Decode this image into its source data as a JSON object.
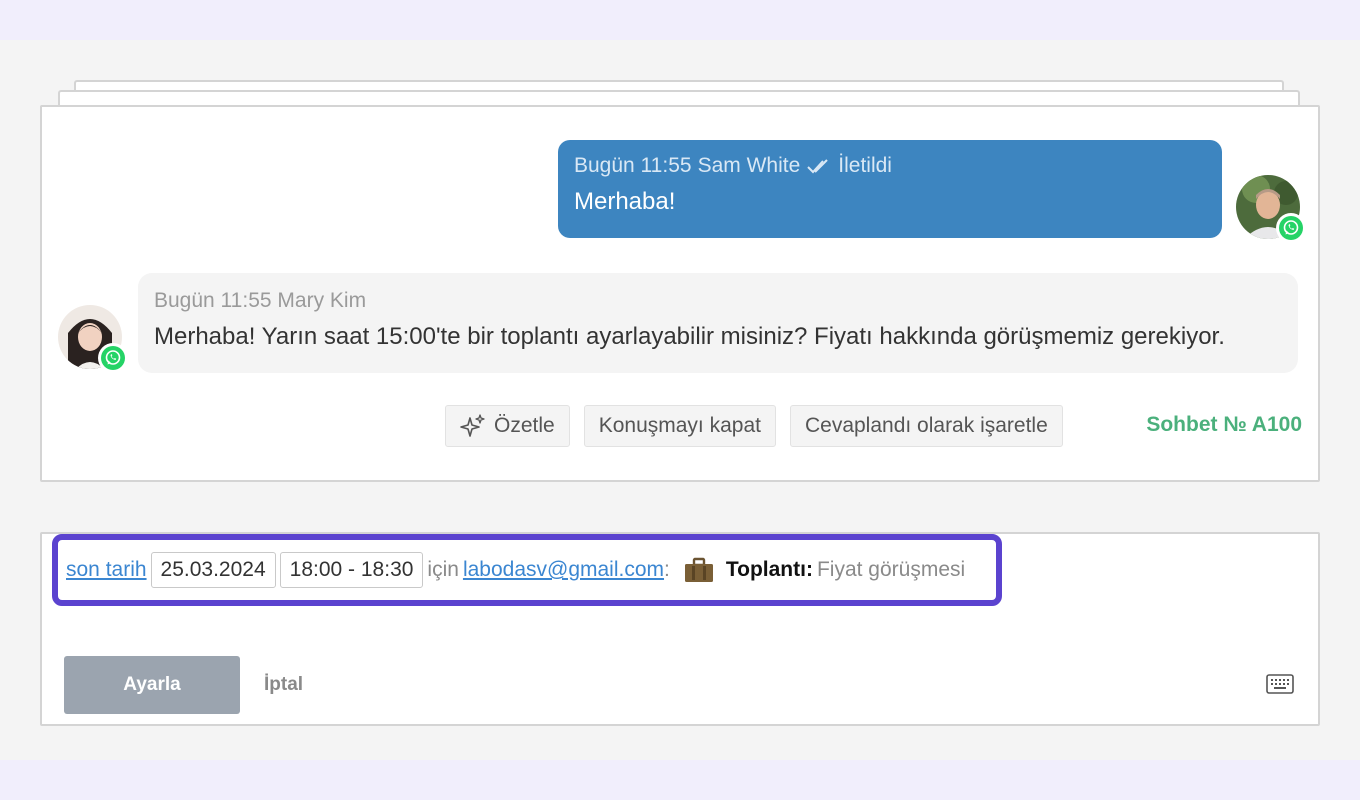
{
  "chat": {
    "outgoing": {
      "time": "Bugün 11:55",
      "author": "Sam White",
      "status": "İletildi",
      "text": "Merhaba!",
      "channel_icon": "whatsapp-icon"
    },
    "incoming": {
      "time": "Bugün 11:55",
      "author": "Mary Kim",
      "text": "Merhaba! Yarın saat 15:00'te bir toplantı ayarlayabilir misiniz? Fiyatı hakkında görüşmemiz gerekiyor.",
      "channel_icon": "whatsapp-icon"
    },
    "actions": {
      "summarize": "Özetle",
      "close": "Konuşmayı kapat",
      "mark_answered": "Cevaplandı olarak işaretle"
    },
    "chat_number": "Sohbet № A100"
  },
  "composer": {
    "deadline_link": "son tarih",
    "date": "25.03.2024",
    "time_range": "18:00 - 18:30",
    "for_label": "için",
    "email": "labodasv@gmail.com",
    "colon": ":",
    "type_label": "Toplantı:",
    "subject": "Fiyat görüşmesi",
    "submit_label": "Ayarla",
    "cancel_label": "İptal"
  },
  "colors": {
    "outgoing_bubble": "#3d85c0",
    "highlight_border": "#5b43cf",
    "chat_number": "#4bb07c",
    "link": "#3b86d1",
    "whatsapp": "#25d366"
  }
}
